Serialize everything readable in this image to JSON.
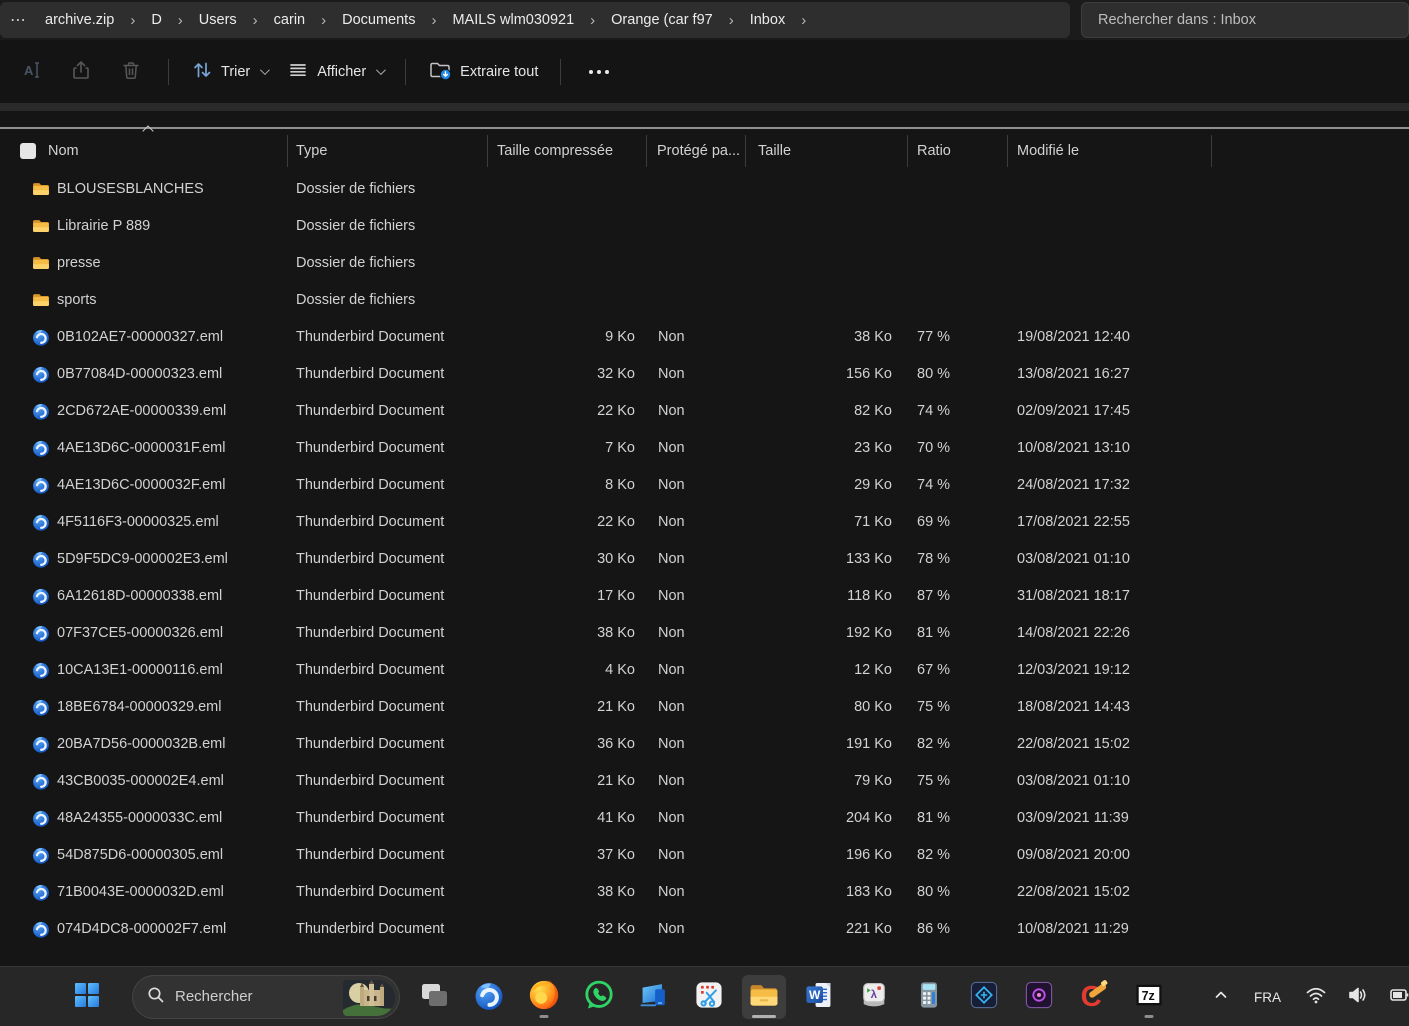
{
  "window": {
    "breadcrumb": {
      "overflow": "⋯",
      "items": [
        "archive.zip",
        "D",
        "Users",
        "carin",
        "Documents",
        "MAILS wlm030921",
        "Orange (car f97",
        "Inbox"
      ],
      "separator": "›"
    },
    "search_box_text": "Rechercher dans : Inbox"
  },
  "toolbar": {
    "sort_label": "Trier",
    "view_label": "Afficher",
    "extract_label": "Extraire tout"
  },
  "table": {
    "headers": {
      "name": "Nom",
      "type": "Type",
      "compressed": "Taille compressée",
      "protected": "Protégé pa...",
      "size": "Taille",
      "ratio": "Ratio",
      "modified": "Modifié le"
    },
    "folders": [
      {
        "name": "BLOUSESBLANCHES",
        "type": "Dossier de fichiers"
      },
      {
        "name": "Librairie P 889",
        "type": "Dossier de fichiers"
      },
      {
        "name": "presse",
        "type": "Dossier de fichiers"
      },
      {
        "name": "sports",
        "type": "Dossier de fichiers"
      }
    ],
    "files": [
      {
        "name": "0B102AE7-00000327.eml",
        "type": "Thunderbird Document",
        "compressed": "9 Ko",
        "protected": "Non",
        "size": "38 Ko",
        "ratio": "77 %",
        "modified": "19/08/2021 12:40"
      },
      {
        "name": "0B77084D-00000323.eml",
        "type": "Thunderbird Document",
        "compressed": "32 Ko",
        "protected": "Non",
        "size": "156 Ko",
        "ratio": "80 %",
        "modified": "13/08/2021 16:27"
      },
      {
        "name": "2CD672AE-00000339.eml",
        "type": "Thunderbird Document",
        "compressed": "22 Ko",
        "protected": "Non",
        "size": "82 Ko",
        "ratio": "74 %",
        "modified": "02/09/2021 17:45"
      },
      {
        "name": "4AE13D6C-0000031F.eml",
        "type": "Thunderbird Document",
        "compressed": "7 Ko",
        "protected": "Non",
        "size": "23 Ko",
        "ratio": "70 %",
        "modified": "10/08/2021 13:10"
      },
      {
        "name": "4AE13D6C-0000032F.eml",
        "type": "Thunderbird Document",
        "compressed": "8 Ko",
        "protected": "Non",
        "size": "29 Ko",
        "ratio": "74 %",
        "modified": "24/08/2021 17:32"
      },
      {
        "name": "4F5116F3-00000325.eml",
        "type": "Thunderbird Document",
        "compressed": "22 Ko",
        "protected": "Non",
        "size": "71 Ko",
        "ratio": "69 %",
        "modified": "17/08/2021 22:55"
      },
      {
        "name": "5D9F5DC9-000002E3.eml",
        "type": "Thunderbird Document",
        "compressed": "30 Ko",
        "protected": "Non",
        "size": "133 Ko",
        "ratio": "78 %",
        "modified": "03/08/2021 01:10"
      },
      {
        "name": "6A12618D-00000338.eml",
        "type": "Thunderbird Document",
        "compressed": "17 Ko",
        "protected": "Non",
        "size": "118 Ko",
        "ratio": "87 %",
        "modified": "31/08/2021 18:17"
      },
      {
        "name": "07F37CE5-00000326.eml",
        "type": "Thunderbird Document",
        "compressed": "38 Ko",
        "protected": "Non",
        "size": "192 Ko",
        "ratio": "81 %",
        "modified": "14/08/2021 22:26"
      },
      {
        "name": "10CA13E1-00000116.eml",
        "type": "Thunderbird Document",
        "compressed": "4 Ko",
        "protected": "Non",
        "size": "12 Ko",
        "ratio": "67 %",
        "modified": "12/03/2021 19:12"
      },
      {
        "name": "18BE6784-00000329.eml",
        "type": "Thunderbird Document",
        "compressed": "21 Ko",
        "protected": "Non",
        "size": "80 Ko",
        "ratio": "75 %",
        "modified": "18/08/2021 14:43"
      },
      {
        "name": "20BA7D56-0000032B.eml",
        "type": "Thunderbird Document",
        "compressed": "36 Ko",
        "protected": "Non",
        "size": "191 Ko",
        "ratio": "82 %",
        "modified": "22/08/2021 15:02"
      },
      {
        "name": "43CB0035-000002E4.eml",
        "type": "Thunderbird Document",
        "compressed": "21 Ko",
        "protected": "Non",
        "size": "79 Ko",
        "ratio": "75 %",
        "modified": "03/08/2021 01:10"
      },
      {
        "name": "48A24355-0000033C.eml",
        "type": "Thunderbird Document",
        "compressed": "41 Ko",
        "protected": "Non",
        "size": "204 Ko",
        "ratio": "81 %",
        "modified": "03/09/2021 11:39"
      },
      {
        "name": "54D875D6-00000305.eml",
        "type": "Thunderbird Document",
        "compressed": "37 Ko",
        "protected": "Non",
        "size": "196 Ko",
        "ratio": "82 %",
        "modified": "09/08/2021 20:00"
      },
      {
        "name": "71B0043E-0000032D.eml",
        "type": "Thunderbird Document",
        "compressed": "38 Ko",
        "protected": "Non",
        "size": "183 Ko",
        "ratio": "80 %",
        "modified": "22/08/2021 15:02"
      },
      {
        "name": "074D4DC8-000002F7.eml",
        "type": "Thunderbird Document",
        "compressed": "32 Ko",
        "protected": "Non",
        "size": "221 Ko",
        "ratio": "86 %",
        "modified": "10/08/2021 11:29"
      }
    ]
  },
  "taskbar": {
    "search_label": "Rechercher",
    "tray_language": "FRA",
    "icons": [
      "task-view",
      "thunderbird",
      "firefox",
      "whatsapp",
      "phone-link",
      "snipping-tool",
      "file-explorer",
      "word",
      "keycap-app",
      "calculator",
      "photoshop-elements",
      "premiere-elements",
      "ccleaner",
      "7-zip"
    ]
  },
  "colors": {
    "accent_blue": "#2e86e0",
    "folder_yellow": "#f5bd45",
    "thunderbird_blue": "#1565d8",
    "taskbar_bg": "#272727",
    "content_bg": "#151515"
  }
}
